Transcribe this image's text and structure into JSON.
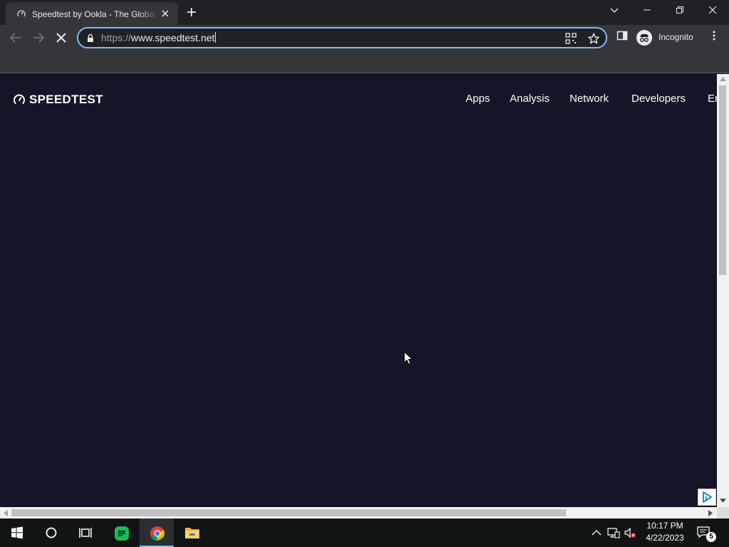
{
  "browser": {
    "tab": {
      "title": "Speedtest by Ookla - The Global Broadband Speed Test"
    },
    "omnibox": {
      "scheme": "https://",
      "host": "www.speedtest.net"
    },
    "profile_label": "Incognito"
  },
  "page": {
    "logo_text": "SPEEDTEST",
    "nav": [
      "Apps",
      "Analysis",
      "Network",
      "Developers",
      "Enterprise"
    ],
    "background_color": "#141526"
  },
  "taskbar": {
    "time": "10:17 PM",
    "date": "4/22/2023",
    "notification_count": "5"
  },
  "colors": {
    "accent": "#8ab4f8",
    "chrome_dark": "#202124",
    "chrome_toolbar": "#35363a"
  },
  "icons": [
    "speedtest-favicon-icon",
    "close-icon",
    "plus-icon",
    "chevron-down-icon",
    "minimize-icon",
    "restore-icon",
    "back-arrow-icon",
    "forward-arrow-icon",
    "stop-loading-icon",
    "lock-icon",
    "qr-code-icon",
    "star-icon",
    "side-panel-icon",
    "incognito-icon",
    "kebab-menu-icon",
    "windows-start-icon",
    "cortana-search-icon",
    "task-view-icon",
    "notes-app-icon",
    "chrome-icon",
    "file-explorer-icon",
    "chevron-up-icon",
    "network-icon",
    "volume-muted-icon",
    "notification-center-icon",
    "adchoices-icon",
    "mouse-cursor-icon"
  ]
}
